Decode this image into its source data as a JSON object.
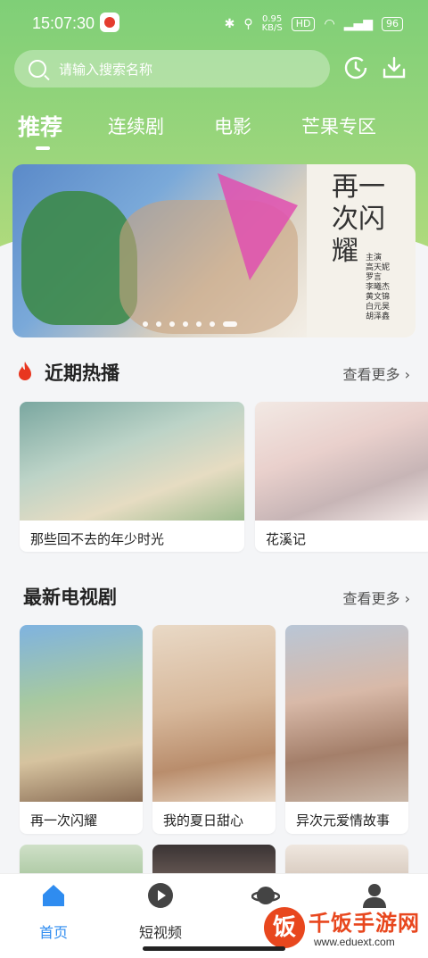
{
  "status_bar": {
    "time": "15:07:30",
    "speed": "0.95\nKB/S",
    "hd": "HD",
    "battery": "96"
  },
  "search": {
    "placeholder": "请输入搜索名称"
  },
  "tabs": [
    {
      "label": "推荐",
      "active": true
    },
    {
      "label": "连续剧"
    },
    {
      "label": "电影"
    },
    {
      "label": "芒果专区"
    }
  ],
  "banner": {
    "title": "再一次闪耀",
    "cast": "主演\n高天妮\n罗言\n李曦杰\n黄文锦\n白元昊\n胡泽鑫",
    "slide_count": 7,
    "active_slide": 7
  },
  "recent": {
    "title": "近期热播",
    "more": "查看更多",
    "items": [
      {
        "label": "那些回不去的年少时光"
      },
      {
        "label": "花溪记"
      }
    ]
  },
  "latest_tv": {
    "title": "最新电视剧",
    "more": "查看更多",
    "items": [
      {
        "label": "再一次闪耀"
      },
      {
        "label": "我的夏日甜心"
      },
      {
        "label": "异次元爱情故事"
      }
    ]
  },
  "bottom_nav": [
    {
      "label": "首页",
      "icon": "home-icon",
      "active": true
    },
    {
      "label": "短视频",
      "icon": "play-icon"
    },
    {
      "label": "",
      "icon": "planet-icon"
    },
    {
      "label": "",
      "icon": "user-icon"
    }
  ],
  "watermark": {
    "text": "千饭手游网",
    "url": "www.eduext.com"
  },
  "colors": {
    "accent": "#2f8cf0",
    "header_green": "#7fcf77",
    "fire": "#e8361f"
  }
}
